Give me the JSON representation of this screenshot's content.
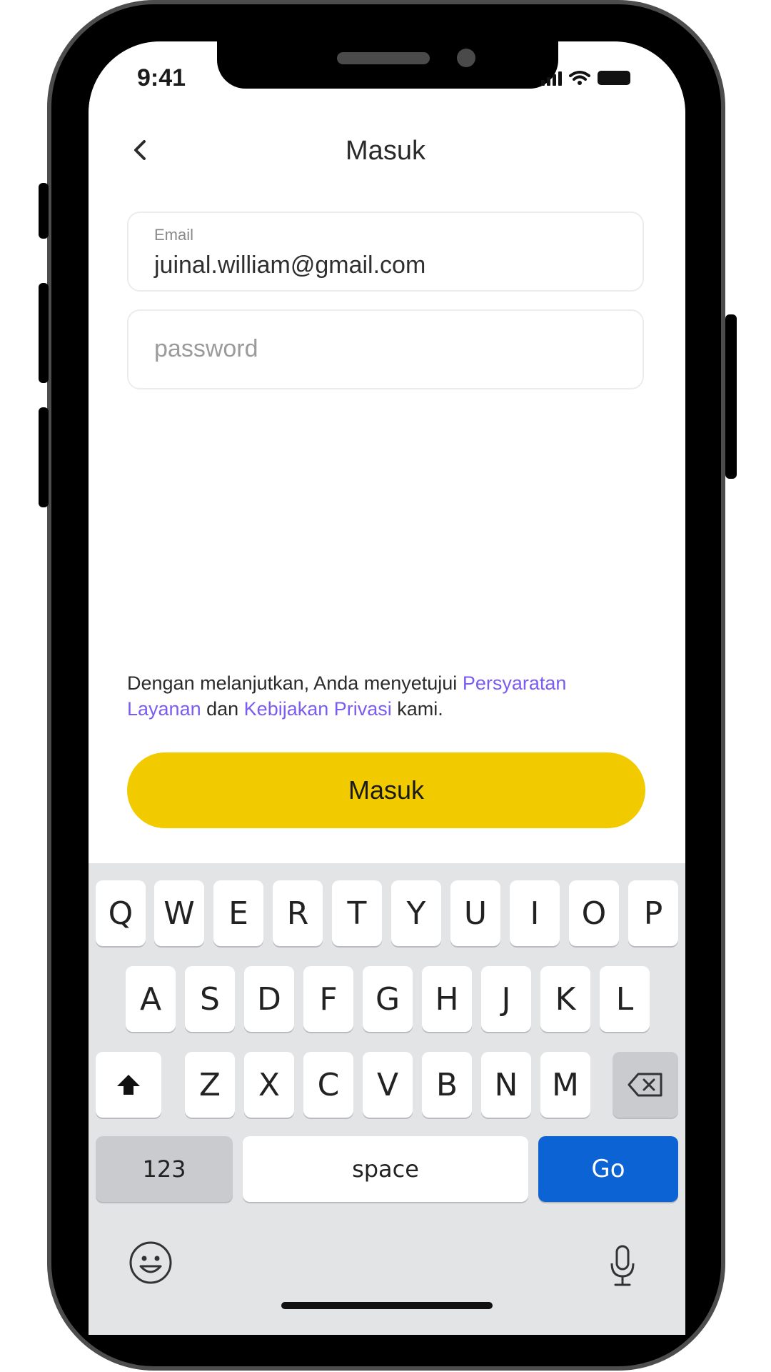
{
  "status_bar": {
    "time": "9:41"
  },
  "header": {
    "title": "Masuk"
  },
  "email_field": {
    "label": "Email",
    "value": "juinal.william@gmail.com"
  },
  "password_field": {
    "placeholder": "password"
  },
  "terms": {
    "prefix": "Dengan melanjutkan, Anda menyetujui ",
    "tos_link": "Persyaratan Layanan",
    "middle": " dan ",
    "privacy_link": "Kebijakan Privasi",
    "suffix": " kami."
  },
  "submit_button": {
    "label": "Masuk"
  },
  "keyboard": {
    "row1": [
      "Q",
      "W",
      "E",
      "R",
      "T",
      "Y",
      "U",
      "I",
      "O",
      "P"
    ],
    "row2": [
      "A",
      "S",
      "D",
      "F",
      "G",
      "H",
      "J",
      "K",
      "L"
    ],
    "row3": [
      "Z",
      "X",
      "C",
      "V",
      "B",
      "N",
      "M"
    ],
    "numbers_key": "123",
    "space_key": "space",
    "go_key": "Go"
  },
  "colors": {
    "accent": "#f1cb00",
    "link": "#7a5cf0",
    "go": "#0b63d4"
  },
  "icons": [
    "back-arrow-icon",
    "signal-icon",
    "wifi-icon",
    "battery-icon",
    "shift-icon",
    "backspace-icon",
    "emoji-icon",
    "microphone-icon"
  ]
}
